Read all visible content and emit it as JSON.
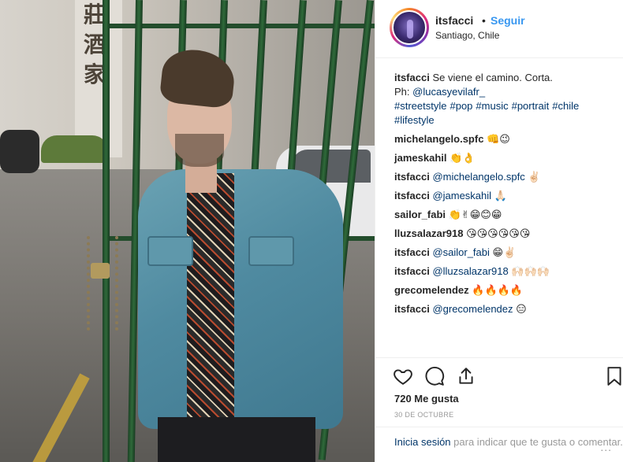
{
  "photo": {
    "alt_hanzi": [
      "莊",
      "酒",
      "家"
    ]
  },
  "header": {
    "username": "itsfacci",
    "separator": "•",
    "follow_label": "Seguir",
    "location": "Santiago, Chile"
  },
  "caption": {
    "username": "itsfacci",
    "text": "Se viene el camino. Corta.",
    "ph_prefix": "Ph:",
    "ph_handle": "@lucasyevilafr_",
    "hashtags": [
      "#streetstyle",
      "#pop",
      "#music",
      "#portrait",
      "#chile",
      "#lifestyle"
    ]
  },
  "comments": [
    {
      "user": "michelangelo.spfc",
      "mention": "",
      "text": "👊😉"
    },
    {
      "user": "jameskahil",
      "mention": "",
      "text": "👏👌"
    },
    {
      "user": "itsfacci",
      "mention": "@michelangelo.spfc",
      "text": "✌🏻"
    },
    {
      "user": "itsfacci",
      "mention": "@jameskahil",
      "text": "🙏🏻"
    },
    {
      "user": "sailor_fabi",
      "mention": "",
      "text": "👏✌😁😊😁"
    },
    {
      "user": "lluzsalazar918",
      "mention": "",
      "text": "😘😘😘😘😘😘"
    },
    {
      "user": "itsfacci",
      "mention": "@sailor_fabi",
      "text": "😁✌🏻"
    },
    {
      "user": "itsfacci",
      "mention": "@lluzsalazar918",
      "text": "🙌🏻🙌🏻🙌🏻"
    },
    {
      "user": "grecomelendez",
      "mention": "",
      "text": "🔥🔥🔥🔥"
    },
    {
      "user": "itsfacci",
      "mention": "@grecomelendez",
      "text": "😑"
    }
  ],
  "actions": {
    "like_icon": "heart-icon",
    "comment_icon": "comment-icon",
    "share_icon": "share-icon",
    "save_icon": "bookmark-icon"
  },
  "likes": "720 Me gusta",
  "date": "30 DE OCTUBRE",
  "login": {
    "link": "Inicia sesión",
    "rest": "para indicar que te gusta o comentar."
  },
  "more": "..."
}
